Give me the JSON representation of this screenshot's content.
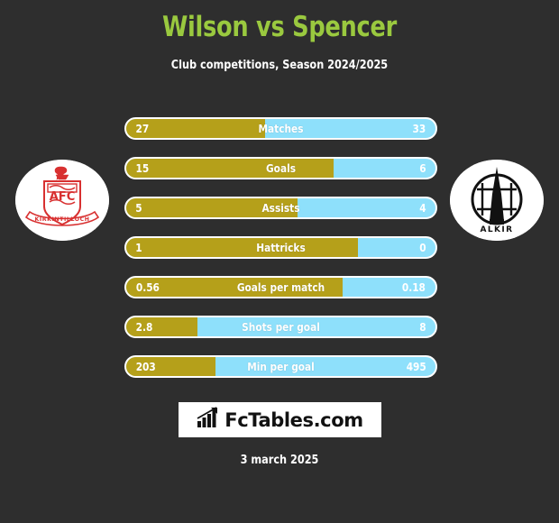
{
  "header": {
    "title": "Wilson vs Spencer",
    "subtitle": "Club competitions, Season 2024/2025",
    "title_color": "#9ac93f",
    "subtitle_color": "#ffffff"
  },
  "theme": {
    "background": "#2e2e2e",
    "left_color": "#b5a01a",
    "right_color": "#8ee0fb",
    "border_color": "#ffffff"
  },
  "badges": {
    "left": {
      "name": "left-club-badge",
      "club_text": "AFC",
      "banner_text": "KIRKINTILLOCH",
      "primary_color": "#d83030"
    },
    "right": {
      "name": "right-club-badge",
      "banner_text": "ALKIR",
      "primary_color": "#111111"
    }
  },
  "chart_data": {
    "type": "bar",
    "title": "Wilson vs Spencer",
    "subtitle": "Club competitions, Season 2024/2025",
    "orientation": "horizontal-diverging",
    "series": [
      {
        "name": "Wilson",
        "color": "#b5a01a",
        "side": "left"
      },
      {
        "name": "Spencer",
        "color": "#8ee0fb",
        "side": "right"
      }
    ],
    "categories": [
      "Matches",
      "Goals",
      "Assists",
      "Hattricks",
      "Goals per match",
      "Shots per goal",
      "Min per goal"
    ],
    "rows": [
      {
        "label": "Matches",
        "left_value": "27",
        "right_value": "33",
        "left_pct": 45
      },
      {
        "label": "Goals",
        "left_value": "15",
        "right_value": "6",
        "left_pct": 67
      },
      {
        "label": "Assists",
        "left_value": "5",
        "right_value": "4",
        "left_pct": 55.5
      },
      {
        "label": "Hattricks",
        "left_value": "1",
        "right_value": "0",
        "left_pct": 75
      },
      {
        "label": "Goals per match",
        "left_value": "0.56",
        "right_value": "0.18",
        "left_pct": 70
      },
      {
        "label": "Shots per goal",
        "left_value": "2.8",
        "right_value": "8",
        "left_pct": 23
      },
      {
        "label": "Min per goal",
        "left_value": "203",
        "right_value": "495",
        "left_pct": 29
      }
    ]
  },
  "footer": {
    "logo_text": "FcTables.com",
    "logo_icon": "bar-chart-icon",
    "date": "3 march 2025"
  }
}
